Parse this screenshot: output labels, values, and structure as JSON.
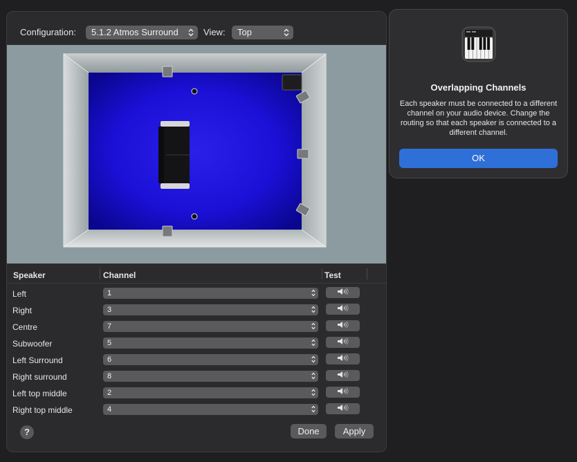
{
  "toolbar": {
    "configuration_label": "Configuration:",
    "configuration_value": "5.1.2 Atmos Surround",
    "view_label": "View:",
    "view_value": "Top"
  },
  "table": {
    "headers": {
      "speaker": "Speaker",
      "channel": "Channel",
      "test": "Test"
    },
    "rows": [
      {
        "speaker": "Left",
        "channel": "1"
      },
      {
        "speaker": "Right",
        "channel": "3"
      },
      {
        "speaker": "Centre",
        "channel": "7"
      },
      {
        "speaker": "Subwoofer",
        "channel": "5"
      },
      {
        "speaker": "Left Surround",
        "channel": "6"
      },
      {
        "speaker": "Right surround",
        "channel": "8"
      },
      {
        "speaker": "Left top middle",
        "channel": "2"
      },
      {
        "speaker": "Right top middle",
        "channel": "4"
      }
    ]
  },
  "footer": {
    "help_label": "?",
    "done_label": "Done",
    "apply_label": "Apply"
  },
  "alert": {
    "title": "Overlapping Channels",
    "message": "Each speaker must be connected to a different channel on your audio device. Change the routing so that each speaker is connected to a different channel.",
    "ok_label": "OK"
  },
  "colors": {
    "accent": "#2f6fd8",
    "room_floor": "#1a10d6"
  },
  "icons": {
    "popup_chevron": "chevron-updown-icon",
    "speaker_test": "speaker-volume-icon",
    "app": "piano-keyboard-icon"
  }
}
